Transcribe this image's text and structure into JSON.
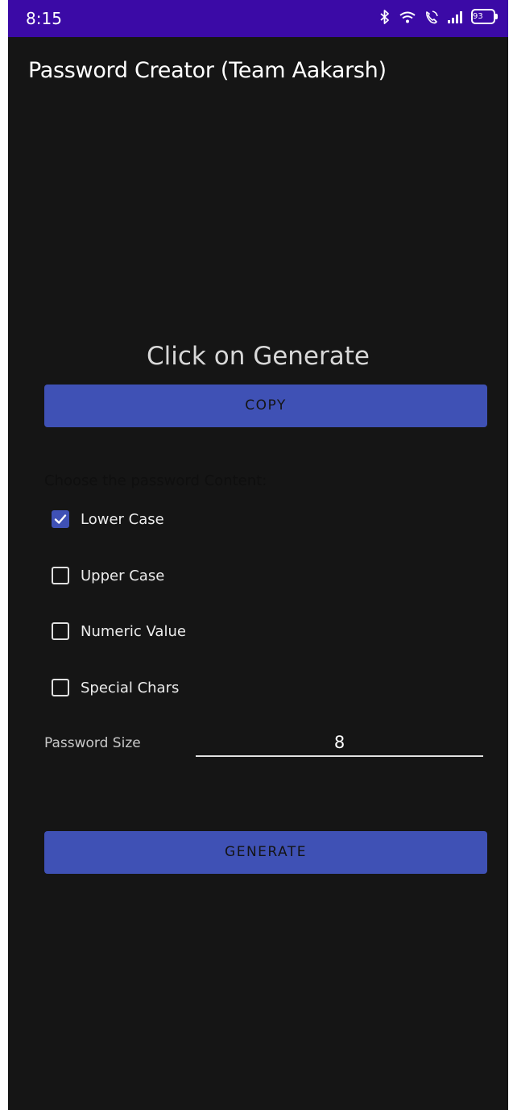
{
  "status_bar": {
    "time": "8:15",
    "battery": "93",
    "icons": [
      "bluetooth-icon",
      "wifi-icon",
      "call-icon",
      "signal-icon",
      "battery-icon"
    ]
  },
  "app": {
    "title": "Password Creator (Team Aakarsh)"
  },
  "result": {
    "text": "Click on Generate"
  },
  "copy_button": {
    "label": "COPY"
  },
  "content_options": {
    "label": "Choose the password Content:",
    "items": [
      {
        "label": "Lower Case",
        "checked": true
      },
      {
        "label": "Upper Case",
        "checked": false
      },
      {
        "label": "Numeric Value",
        "checked": false
      },
      {
        "label": "Special Chars",
        "checked": false
      }
    ]
  },
  "password_size": {
    "label": "Password Size",
    "value": "8"
  },
  "generate_button": {
    "label": "GENERATE"
  },
  "colors": {
    "status_bar": "#3b0aa6",
    "background": "#151515",
    "accent": "#3f51b5"
  }
}
